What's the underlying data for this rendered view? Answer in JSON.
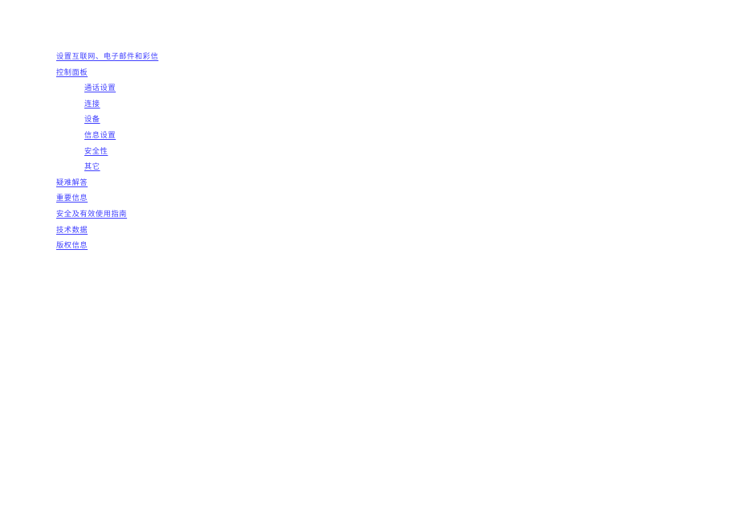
{
  "document": {
    "type": "table-of-contents",
    "background_color": "#ffffff",
    "link_color": "#4040ff",
    "entries": [
      {
        "label": "设置互联网、电子邮件和彩信",
        "level": 0
      },
      {
        "label": "控制面板",
        "level": 0
      },
      {
        "label": "通话设置",
        "level": 1
      },
      {
        "label": "连接",
        "level": 1
      },
      {
        "label": "设备",
        "level": 1
      },
      {
        "label": "信息设置",
        "level": 1
      },
      {
        "label": "安全性",
        "level": 1
      },
      {
        "label": "其它",
        "level": 1
      },
      {
        "label": "疑难解答",
        "level": 0
      },
      {
        "label": "重要信息",
        "level": 0
      },
      {
        "label": "安全及有效使用指南",
        "level": 0
      },
      {
        "label": "技术数据",
        "level": 0
      },
      {
        "label": "版权信息",
        "level": 0
      }
    ]
  }
}
